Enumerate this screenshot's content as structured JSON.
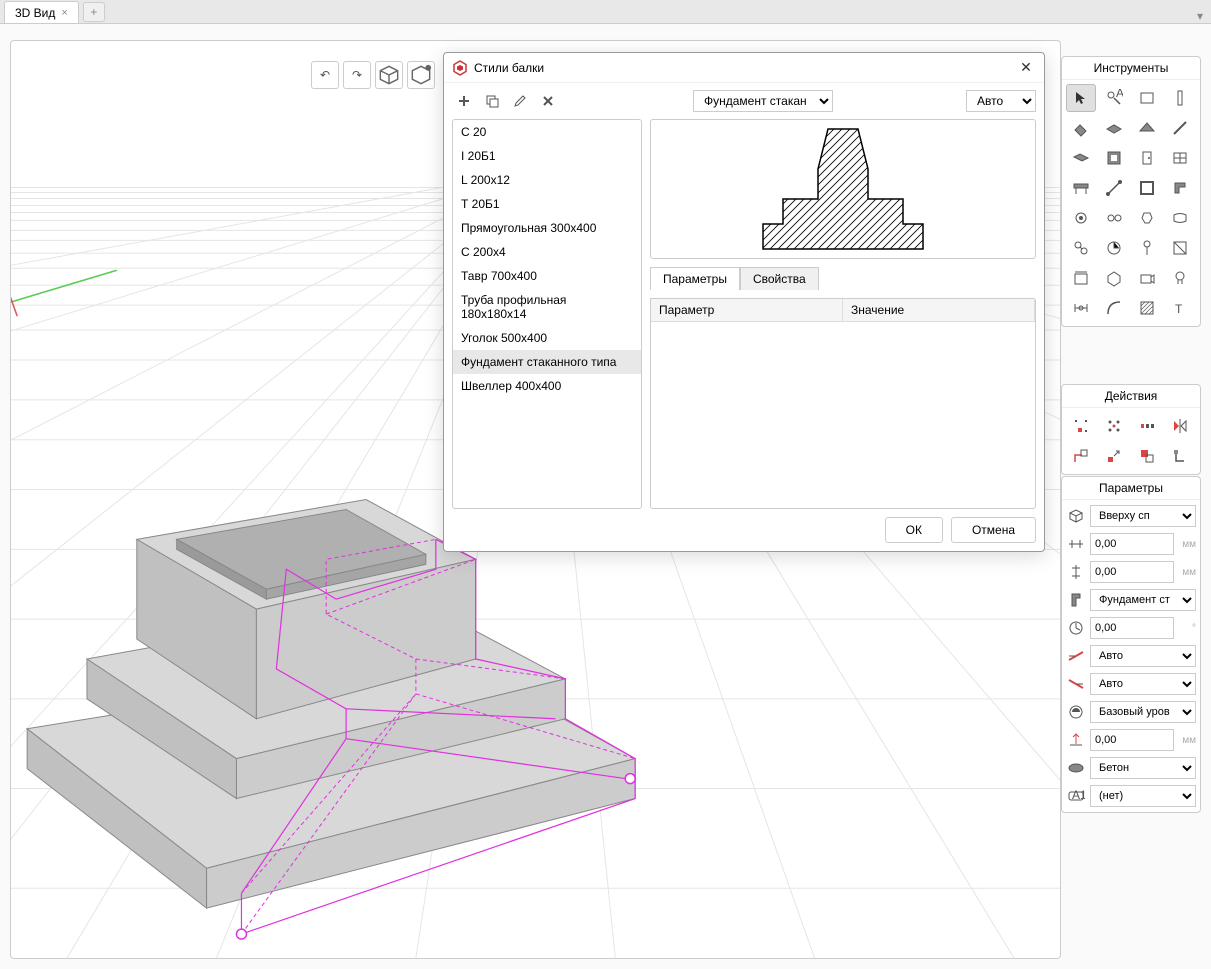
{
  "tab": {
    "label": "3D Вид"
  },
  "dialog": {
    "title": "Стили балки",
    "profile_select": "Фундамент стакан",
    "auto_select": "Авто",
    "styles": [
      "С 20",
      "I 20Б1",
      "L 200x12",
      "Т 20Б1",
      "Прямоугольная 300x400",
      "С 200x4",
      "Тавр 700x400",
      "Труба профильная 180x180x14",
      "Уголок 500x400",
      "Фундамент стаканного типа",
      "Швеллер 400x400"
    ],
    "selected_style_idx": 9,
    "tabs": {
      "params": "Параметры",
      "props": "Свойства"
    },
    "table": {
      "param_col": "Параметр",
      "value_col": "Значение"
    },
    "ok": "ОК",
    "cancel": "Отмена"
  },
  "panels": {
    "tools": "Инструменты",
    "actions": "Действия",
    "params": "Параметры"
  },
  "params": {
    "placement": "Вверху сп",
    "offset1": "0,00",
    "offset2": "0,00",
    "profile": "Фундамент ст",
    "angle": "0,00",
    "cut1": "Авто",
    "cut2": "Авто",
    "level": "Базовый уров",
    "elev": "0,00",
    "material": "Бетон",
    "mark": "(нет)",
    "unit": "мм"
  }
}
